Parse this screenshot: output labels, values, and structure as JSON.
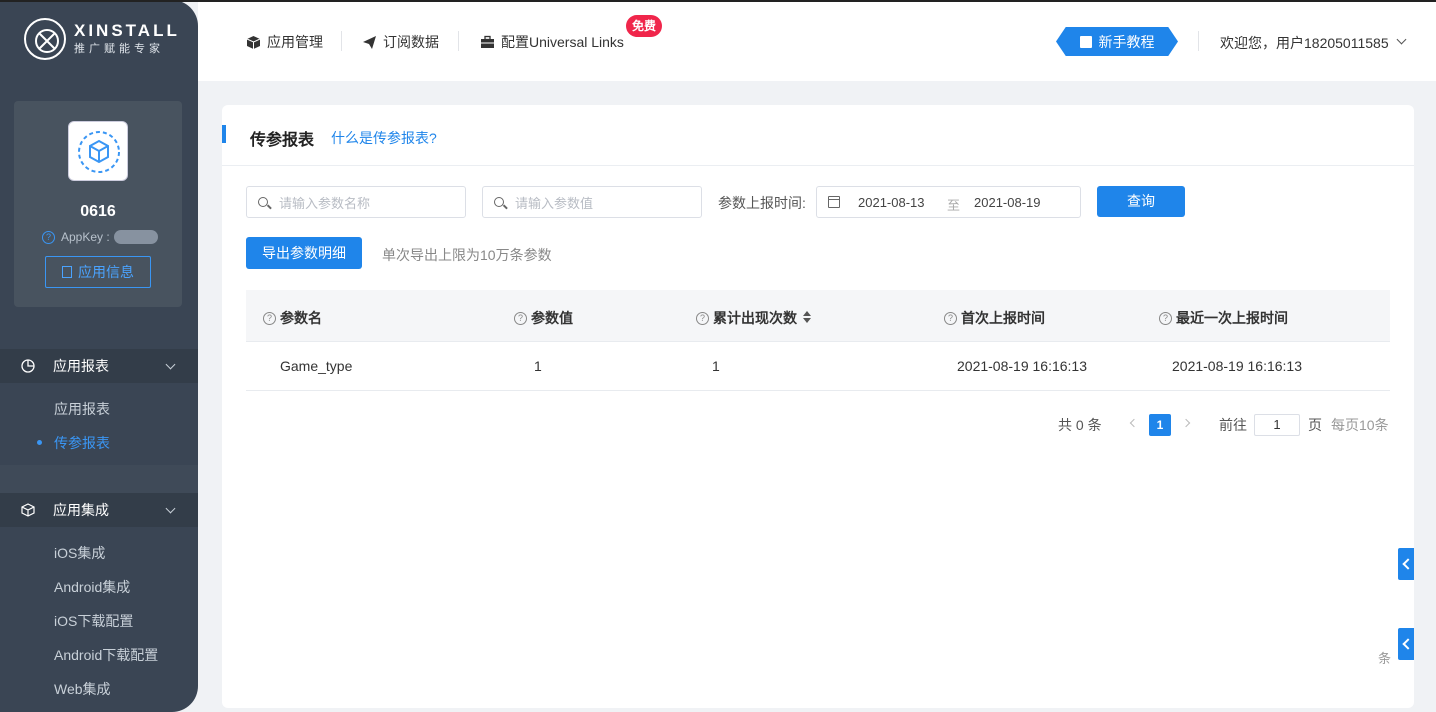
{
  "logo": {
    "main": "XINSTALL",
    "sub": "推广赋能专家"
  },
  "app": {
    "name": "0616",
    "appkey_label": "AppKey :",
    "info_button": "应用信息"
  },
  "sidebar": {
    "groups": [
      {
        "title": "应用报表",
        "items": [
          "应用报表",
          "传参报表"
        ],
        "active": "传参报表"
      },
      {
        "title": "应用集成",
        "items": [
          "iOS集成",
          "Android集成",
          "iOS下载配置",
          "Android下载配置",
          "Web集成"
        ]
      }
    ]
  },
  "header": {
    "nav": [
      "应用管理",
      "订阅数据",
      "配置Universal Links"
    ],
    "free_badge": "免费",
    "tutorial": "新手教程",
    "user": "欢迎您，用户18205011585"
  },
  "page": {
    "title": "传参报表",
    "help_link": "什么是传参报表?",
    "search_name_placeholder": "请输入参数名称",
    "search_value_placeholder": "请输入参数值",
    "time_label": "参数上报时间:",
    "date_start": "2021-08-13",
    "date_sep": "至",
    "date_end": "2021-08-19",
    "query_button": "查询",
    "export_button": "导出参数明细",
    "export_note": "单次导出上限为10万条参数"
  },
  "table": {
    "columns": [
      "参数名",
      "参数值",
      "累计出现次数",
      "首次上报时间",
      "最近一次上报时间"
    ],
    "rows": [
      [
        "Game_type",
        "1",
        "1",
        "2021-08-19 16:16:13",
        "2021-08-19 16:16:13"
      ]
    ]
  },
  "pagination": {
    "total": "共 0 条",
    "current": "1",
    "goto_label": "前往",
    "goto_value": "1",
    "page_unit": "页",
    "per_page": "每页10条"
  },
  "stray_text": "条",
  "colors": {
    "accent": "#1f85ea",
    "sidebar": "#3a4554",
    "badge": "#f0264b"
  }
}
